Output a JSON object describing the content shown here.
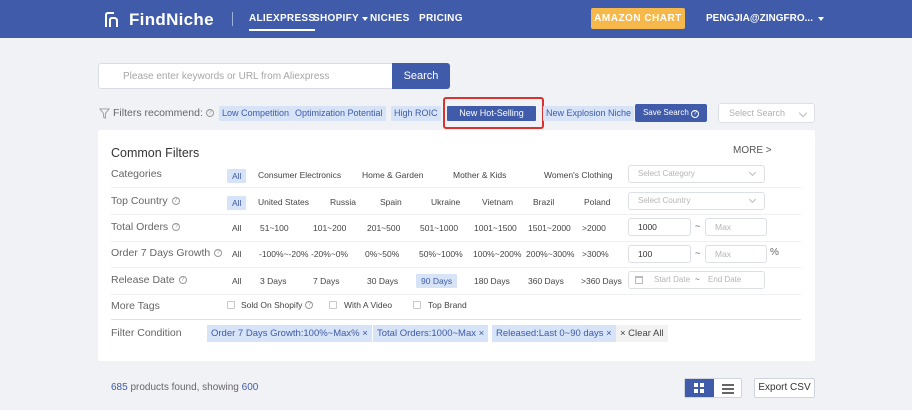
{
  "nav": {
    "brand": "FindNiche",
    "items": [
      {
        "label": "ALIEXPRESS"
      },
      {
        "label": "SHOPIFY"
      },
      {
        "label": "NICHES"
      },
      {
        "label": "PRICING"
      }
    ],
    "amazon_button": "AMAZON CHART",
    "user": "PENGJIA@ZINGFRO..."
  },
  "search": {
    "placeholder": "Please enter keywords or URL from Aliexpress",
    "button": "Search"
  },
  "recommend": {
    "label": "Filters recommend:",
    "tags": [
      {
        "label": "Low Competition",
        "selected": false
      },
      {
        "label": "Optimization Potential",
        "selected": false
      },
      {
        "label": "High ROIC",
        "selected": false
      },
      {
        "label": "New Hot-Selling",
        "selected": true
      },
      {
        "label": "New Explosion Niche",
        "selected": false
      }
    ],
    "save_search": "Save Search",
    "select_search_placeholder": "Select Search"
  },
  "filters": {
    "title": "Common Filters",
    "more": "MORE >",
    "categories": {
      "label": "Categories",
      "options": [
        "All",
        "Consumer Electronics",
        "Home & Garden",
        "Mother & Kids",
        "Women's Clothing"
      ],
      "select_placeholder": "Select Category"
    },
    "top_country": {
      "label": "Top Country",
      "options": [
        "All",
        "United States",
        "Russia",
        "Spain",
        "Ukraine",
        "Vietnam",
        "Brazil",
        "Poland"
      ],
      "select_placeholder": "Select Country"
    },
    "total_orders": {
      "label": "Total Orders",
      "options": [
        "All",
        "51~100",
        "101~200",
        "201~500",
        "501~1000",
        "1001~1500",
        "1501~2000",
        ">2000"
      ],
      "min_value": "1000",
      "max_placeholder": "Max",
      "dash": "~"
    },
    "growth": {
      "label": "Order 7 Days Growth",
      "options": [
        "All",
        "-100%~-20%",
        "-20%~0%",
        "0%~50%",
        "50%~100%",
        "100%~200%",
        "200%~300%",
        ">300%"
      ],
      "min_value": "100",
      "max_placeholder": "Max",
      "unit": "%",
      "dash": "~"
    },
    "release_date": {
      "label": "Release Date",
      "options": [
        "All",
        "3 Days",
        "7 Days",
        "30 Days",
        "90 Days",
        "180 Days",
        "360 Days",
        ">360 Days"
      ],
      "selected": "90 Days",
      "start_placeholder": "Start Date",
      "end_placeholder": "End Date",
      "dash": "~"
    },
    "more_tags": {
      "label": "More Tags",
      "checkboxes": [
        "Sold On Shopify",
        "With A Video",
        "Top Brand"
      ]
    },
    "condition": {
      "label": "Filter Condition",
      "tags": [
        "Order 7 Days Growth:100%~Max% ×",
        "Total Orders:1000~Max ×",
        "Released:Last 0~90 days ×"
      ],
      "clear": "× Clear All"
    }
  },
  "results": {
    "found": "685",
    "found_text": "products found, showing",
    "showing": "600",
    "export": "Export CSV"
  },
  "colors": {
    "primary": "#3f5ba9",
    "accent_amazon": "#f7b84b",
    "tag_bg": "#d7e3f7",
    "highlight": "#d9332f"
  }
}
